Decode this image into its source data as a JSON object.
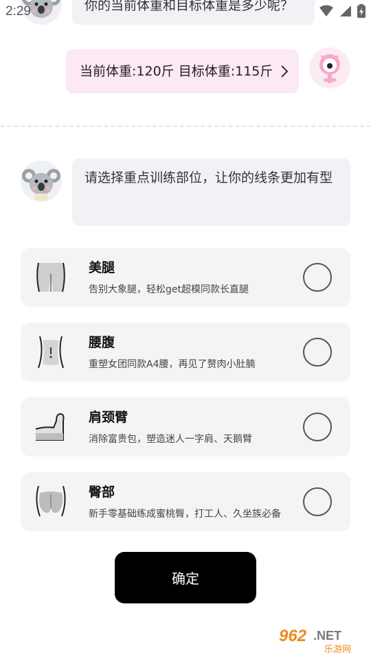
{
  "status_bar": {
    "time": "2:29"
  },
  "chat": {
    "bot_question_1": "你的当前体重和目标体重是多少呢？",
    "user_answer": "当前体重:120斤 目标体重:115斤",
    "bot_question_2": "请选择重点训练部位，让你的线条更加有型"
  },
  "options": [
    {
      "title": "美腿",
      "desc": "告别大象腿，轻松get超模同款长直腿",
      "icon": "legs-icon"
    },
    {
      "title": "腰腹",
      "desc": "重塑女团同款A4腰，再见了赘肉小肚腩",
      "icon": "waist-icon"
    },
    {
      "title": "肩颈臂",
      "desc": "消除富贵包，塑造迷人一字肩、天鹅臂",
      "icon": "arm-icon"
    },
    {
      "title": "臀部",
      "desc": "新手零基础练成蜜桃臀，打工人、久坐族必备",
      "icon": "hips-icon"
    }
  ],
  "confirm_label": "确定",
  "watermark": {
    "brand": "962.NET",
    "sub": "乐游网"
  },
  "colors": {
    "user_bubble": "#fde8f5",
    "bot_bubble": "#f1f2f5",
    "card_bg": "#f3f4f6",
    "confirm_bg": "#000000",
    "watermark_orange": "#f08a1c"
  }
}
